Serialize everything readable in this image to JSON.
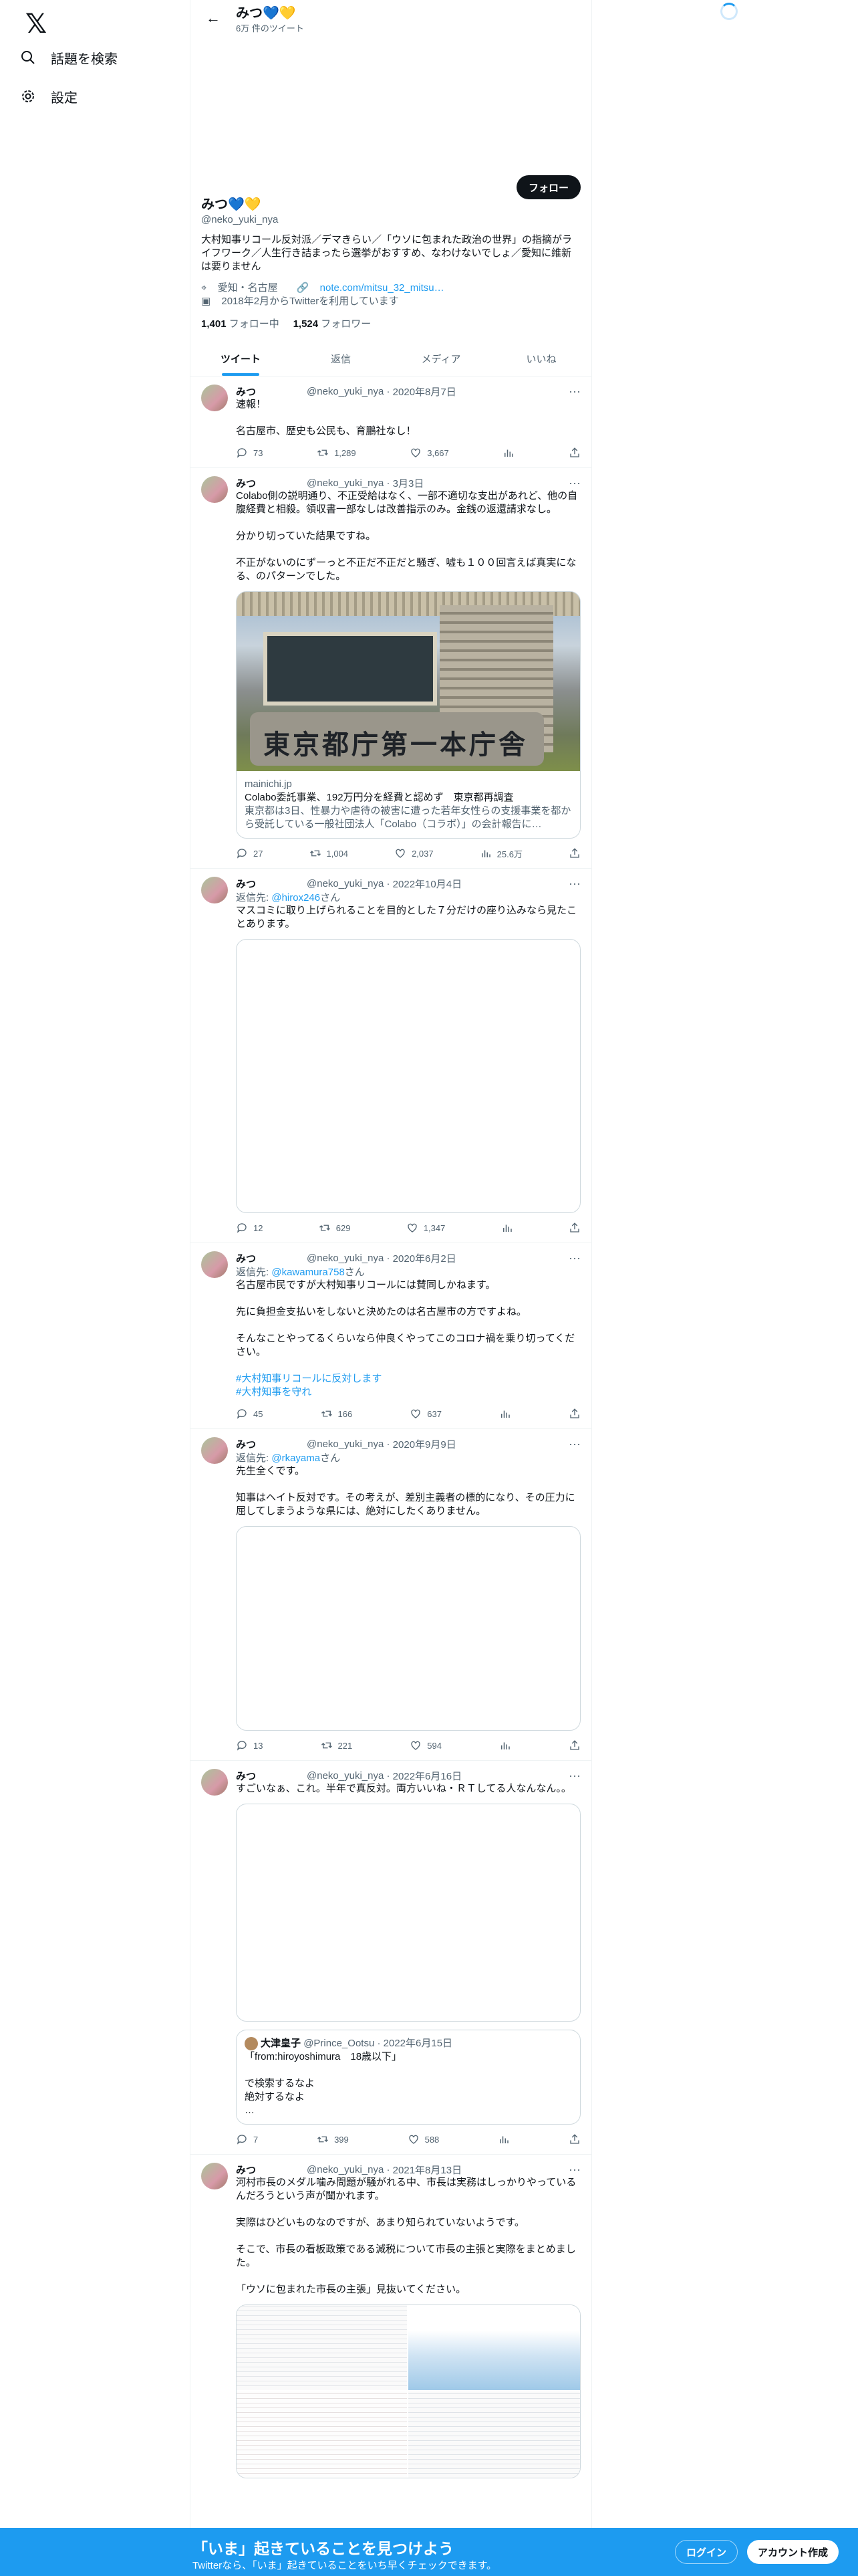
{
  "nav": {
    "search": "話題を検索",
    "settings": "設定"
  },
  "header": {
    "name": "みつ💙💛",
    "tweet_count": "6万 件のツイート"
  },
  "profile": {
    "follow_button": "フォロー",
    "name": "みつ💙💛",
    "handle": "@neko_yuki_nya",
    "bio": "大村知事リコール反対派／デマきらい／「ウソに包まれた政治の世界」の指摘がライフワーク／人生行き詰まったら選挙がおすすめ、なわけないでしょ／愛知に維新は要りません",
    "location": "愛知・名古屋",
    "link": "note.com/mitsu_32_mitsu…",
    "joined": "2018年2月からTwitterを利用しています",
    "following_count": "1,401",
    "following_label": "フォロー中",
    "followers_count": "1,524",
    "followers_label": "フォロワー"
  },
  "tabs": [
    "ツイート",
    "返信",
    "メディア",
    "いいね"
  ],
  "tweets": [
    {
      "name": "みつ",
      "handle": "@neko_yuki_nya",
      "date": "2020年8月7日",
      "text": "速報！\n\n名古屋市、歴史も公民も、育鵬社なし！",
      "reply": "73",
      "retweet": "1,289",
      "like": "3,667",
      "views": ""
    },
    {
      "name": "みつ",
      "handle": "@neko_yuki_nya",
      "date": "3月3日",
      "text": "Colabo側の説明通り、不正受給はなく、一部不適切な支出があれど、他の自腹経費と相殺。領収書一部なしは改善指示のみ。金銭の返還請求なし。\n\n分かり切っていた結果ですね。\n\n不正がないのにずーっと不正だ不正だと騒ぎ、嘘も１００回言えば真実になる、のパターンでした。",
      "reply": "27",
      "retweet": "1,004",
      "like": "2,037",
      "views": "25.6万",
      "card_domain": "mainichi.jp",
      "card_title": "Colabo委託事業、192万円分を経費と認めず　東京都再調査",
      "card_desc": "東京都は3日、性暴力や虐待の被害に遭った若年女性らの支援事業を都から受託している一般社団法人「Colabo（コラボ）」の会計報告に…",
      "card_sign": "東京都庁第一本庁舎"
    },
    {
      "name": "みつ",
      "handle": "@neko_yuki_nya",
      "date": "2022年10月4日",
      "reply_to_label": "返信先:",
      "reply_to": "@hirox246",
      "reply_suffix": "さん",
      "text": "マスコミに取り上げられることを目的とした７分だけの座り込みなら見たことあります。",
      "reply": "12",
      "retweet": "629",
      "like": "1,347",
      "views": ""
    },
    {
      "name": "みつ",
      "handle": "@neko_yuki_nya",
      "date": "2020年6月2日",
      "reply_to_label": "返信先:",
      "reply_to": "@kawamura758",
      "reply_suffix": "さん",
      "text": "名古屋市民ですが大村知事リコールには賛同しかねます。\n\n先に負担金支払いをしないと決めたのは名古屋市の方ですよね。\n\nそんなことやってるくらいなら仲良くやってこのコロナ禍を乗り切ってください。",
      "tag1": "#大村知事リコールに反対します",
      "tag2": "#大村知事を守れ",
      "reply": "45",
      "retweet": "166",
      "like": "637",
      "views": ""
    },
    {
      "name": "みつ",
      "handle": "@neko_yuki_nya",
      "date": "2020年9月9日",
      "reply_to_label": "返信先:",
      "reply_to": "@rkayama",
      "reply_suffix": "さん",
      "text": "先生全くです。\n\n知事はヘイト反対です。その考えが、差別主義者の標的になり、その圧力に屈してしまうような県には、絶対にしたくありません。",
      "reply": "13",
      "retweet": "221",
      "like": "594",
      "views": ""
    },
    {
      "name": "みつ",
      "handle": "@neko_yuki_nya",
      "date": "2022年6月16日",
      "text": "すごいなぁ、これ。半年で真反対。両方いいね・ＲＴしてる人なんなん。。",
      "quote_name": "大津皇子",
      "quote_handle": "@Prince_Ootsu",
      "quote_date": "2022年6月15日",
      "quote_text": "「from:hiroyoshimura　18歳以下」\n\nで検索するなよ\n絶対するなよ\n…",
      "reply": "7",
      "retweet": "399",
      "like": "588",
      "views": ""
    },
    {
      "name": "みつ",
      "handle": "@neko_yuki_nya",
      "date": "2021年8月13日",
      "text": "河村市長のメダル噛み問題が騒がれる中、市長は実務はしっかりやっているんだろうという声が聞かれます。\n\n実際はひどいものなのですが、あまり知られていないようです。\n\nそこで、市長の看板政策である減税について市長の主張と実際をまとめました。\n\n「ウソに包まれた市長の主張」見抜いてください。"
    }
  ],
  "bottom_bar": {
    "title": "「いま」起きていることを見つけよう",
    "subtitle": "Twitterなら、「いま」起きていることをいち早くチェックできます。",
    "login": "ログイン",
    "signup": "アカウント作成"
  }
}
